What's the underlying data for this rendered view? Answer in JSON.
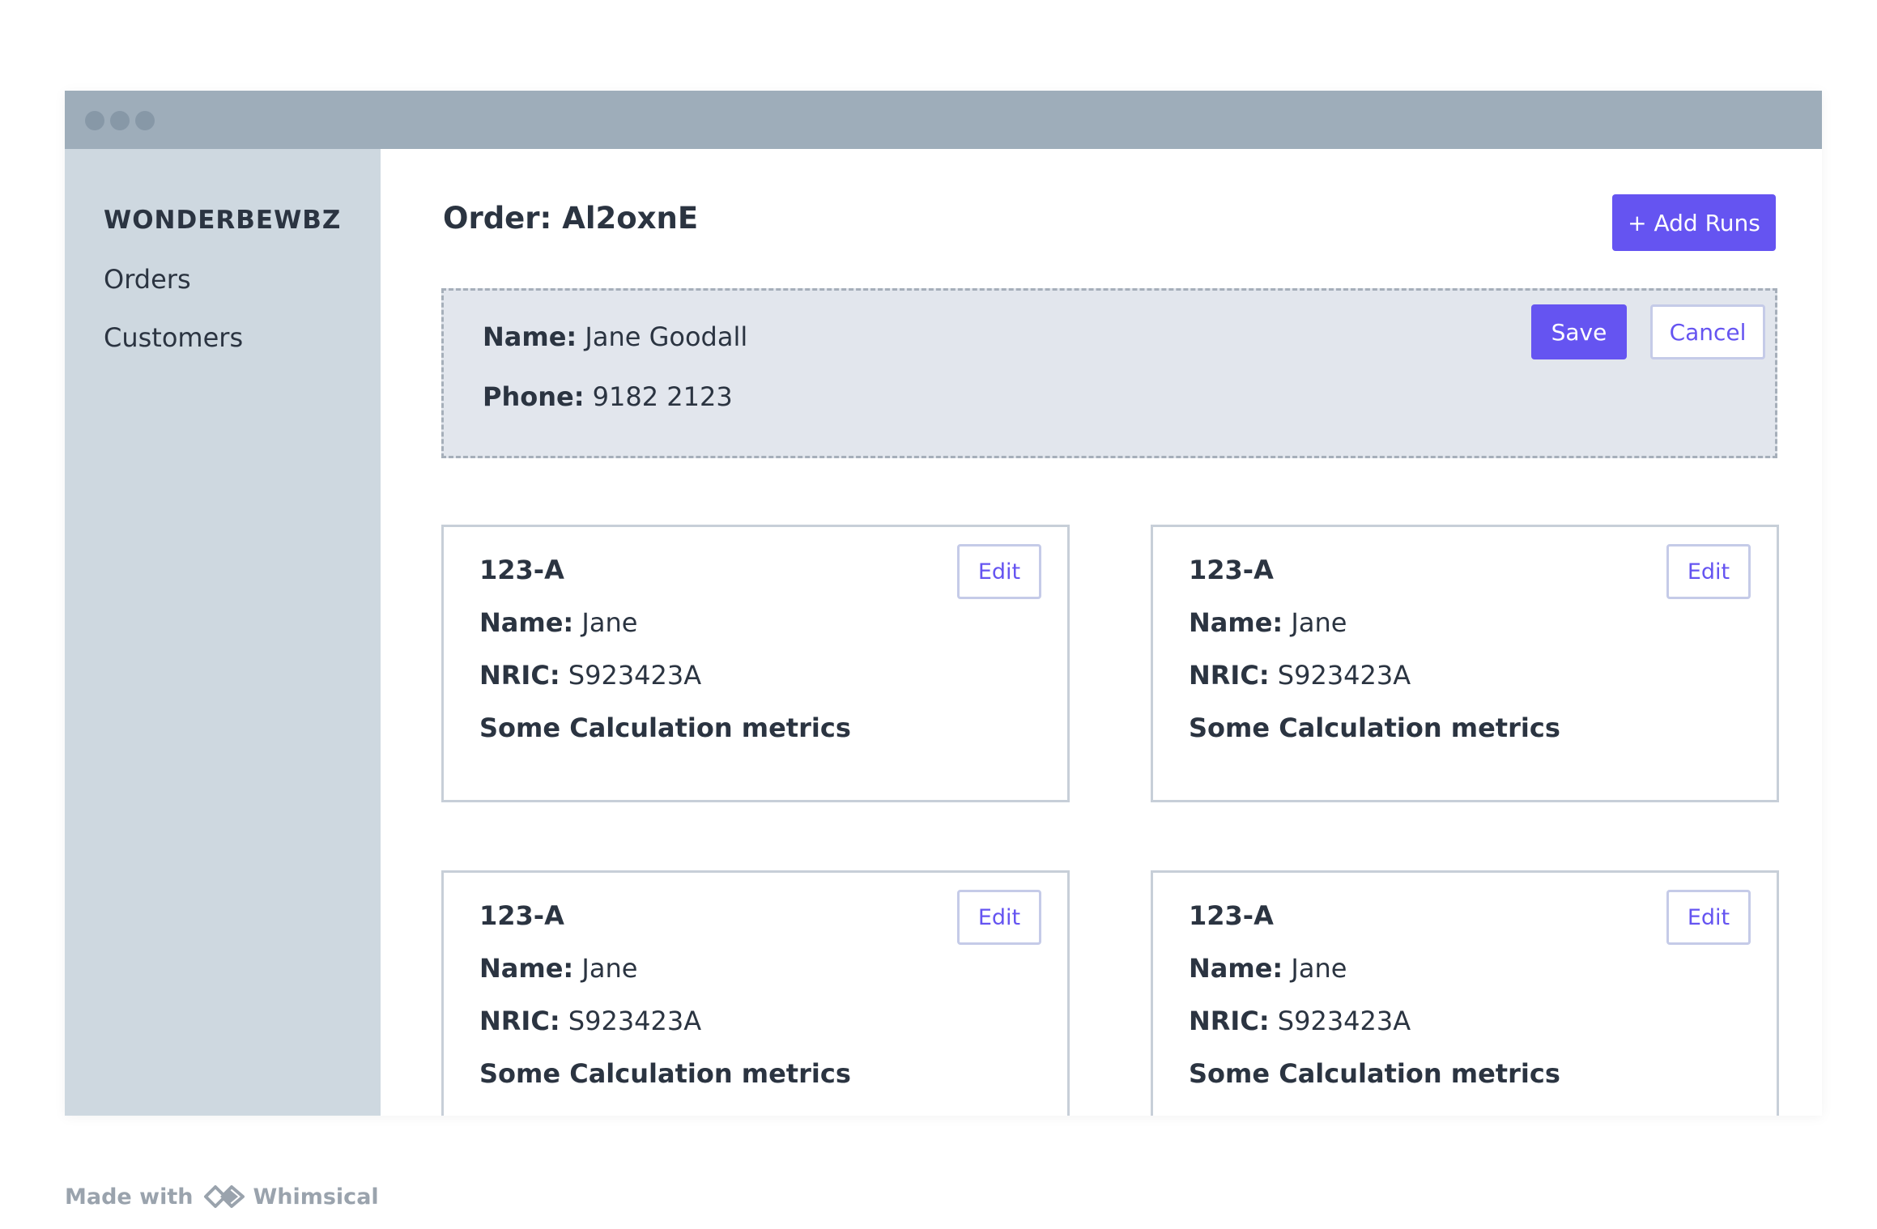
{
  "app": {
    "brand": "WONDERBEWBZ"
  },
  "sidebar": {
    "items": [
      {
        "label": "Orders"
      },
      {
        "label": "Customers"
      }
    ]
  },
  "header": {
    "title": "Order: Al2oxnE",
    "add_runs_label": "+ Add Runs"
  },
  "customer": {
    "name_label": "Name:",
    "name_value": "Jane Goodall",
    "phone_label": "Phone:",
    "phone_value": "9182 2123",
    "save_label": "Save",
    "cancel_label": "Cancel"
  },
  "runs": [
    {
      "id": "123-A",
      "name_label": "Name:",
      "name": "Jane",
      "nric_label": "NRIC:",
      "nric": "S923423A",
      "metrics": "Some Calculation metrics",
      "edit_label": "Edit"
    },
    {
      "id": "123-A",
      "name_label": "Name:",
      "name": "Jane",
      "nric_label": "NRIC:",
      "nric": "S923423A",
      "metrics": "Some Calculation metrics",
      "edit_label": "Edit"
    },
    {
      "id": "123-A",
      "name_label": "Name:",
      "name": "Jane",
      "nric_label": "NRIC:",
      "nric": "S923423A",
      "metrics": "Some Calculation metrics",
      "edit_label": "Edit"
    },
    {
      "id": "123-A",
      "name_label": "Name:",
      "name": "Jane",
      "nric_label": "NRIC:",
      "nric": "S923423A",
      "metrics": "Some Calculation metrics",
      "edit_label": "Edit"
    }
  ],
  "footer": {
    "made_with": "Made with",
    "brand": "Whimsical",
    "logo_icon": "whimsical-logo-icon"
  },
  "colors": {
    "accent": "#6554f1",
    "sidebar_bg": "#ced8e0",
    "titlebar_bg": "#9eadba",
    "panel_bg": "#e2e6ed"
  }
}
